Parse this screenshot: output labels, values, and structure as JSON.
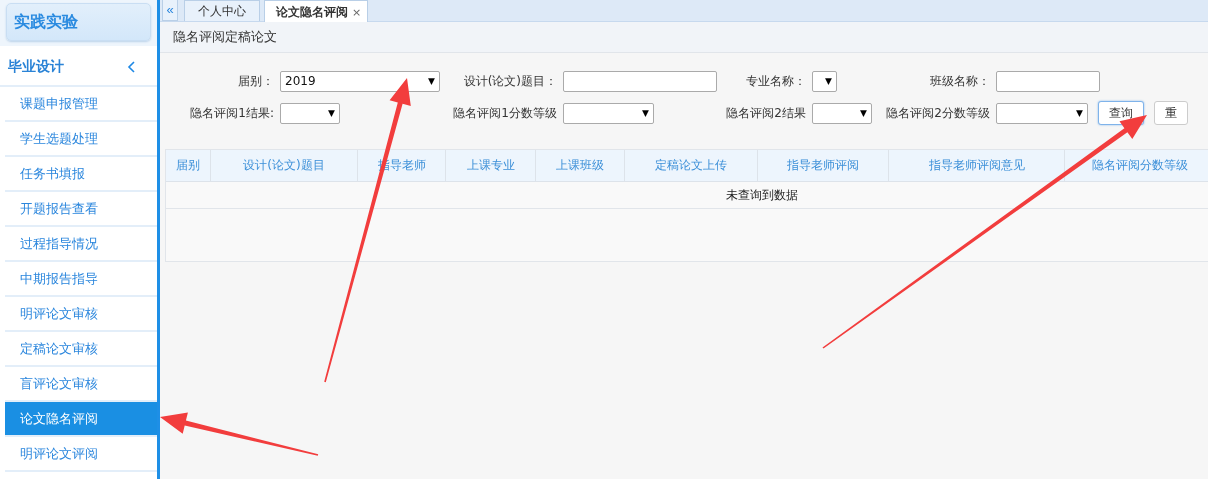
{
  "sidebar": {
    "logo": "实践实验",
    "section": {
      "label": "毕业设计",
      "expanded": true
    },
    "items": [
      {
        "label": "课题申报管理",
        "selected": false
      },
      {
        "label": "学生选题处理",
        "selected": false
      },
      {
        "label": "任务书填报",
        "selected": false
      },
      {
        "label": "开题报告查看",
        "selected": false
      },
      {
        "label": "过程指导情况",
        "selected": false
      },
      {
        "label": "中期报告指导",
        "selected": false
      },
      {
        "label": "明评论文审核",
        "selected": false
      },
      {
        "label": "定稿论文审核",
        "selected": false
      },
      {
        "label": "盲评论文审核",
        "selected": false
      },
      {
        "label": "论文隐名评阅",
        "selected": true
      },
      {
        "label": "明评论文评阅",
        "selected": false
      }
    ]
  },
  "tabs": {
    "collapse": "«",
    "items": [
      {
        "label": "个人中心",
        "selected": false,
        "closable": false
      },
      {
        "label": "论文隐名评阅",
        "selected": true,
        "closable": true,
        "close": "×"
      }
    ]
  },
  "page_title": "隐名评阅定稿论文",
  "filters": [
    {
      "label": "届别：",
      "kind": "select",
      "value": "2019",
      "arrow": "▼"
    },
    {
      "label": "设计(论文)题目：",
      "kind": "input"
    },
    {
      "label": "专业名称：",
      "kind": "select",
      "arrow": "▼"
    },
    {
      "label": "班级名称：",
      "kind": "input"
    },
    {
      "label": "隐名评阅1结果:",
      "kind": "select",
      "arrow": "▼"
    },
    {
      "label": "隐名评阅1分数等级",
      "kind": "select",
      "arrow": "▼"
    },
    {
      "label": "隐名评阅2结果",
      "kind": "select",
      "arrow": "▼"
    },
    {
      "label": "隐名评阅2分数等级",
      "kind": "select",
      "arrow": "▼"
    }
  ],
  "buttons": [
    {
      "label": "查询",
      "focused": true
    },
    {
      "label": "重",
      "focused": false
    }
  ],
  "table": {
    "columns": [
      "届别",
      "设计(论文)题目",
      "指导老师",
      "上课专业",
      "上课班级",
      "定稿论文上传",
      "指导老师评阅",
      "指导老师评阅意见",
      "隐名评阅分数等级"
    ],
    "empty_message": "未查询到数据"
  }
}
